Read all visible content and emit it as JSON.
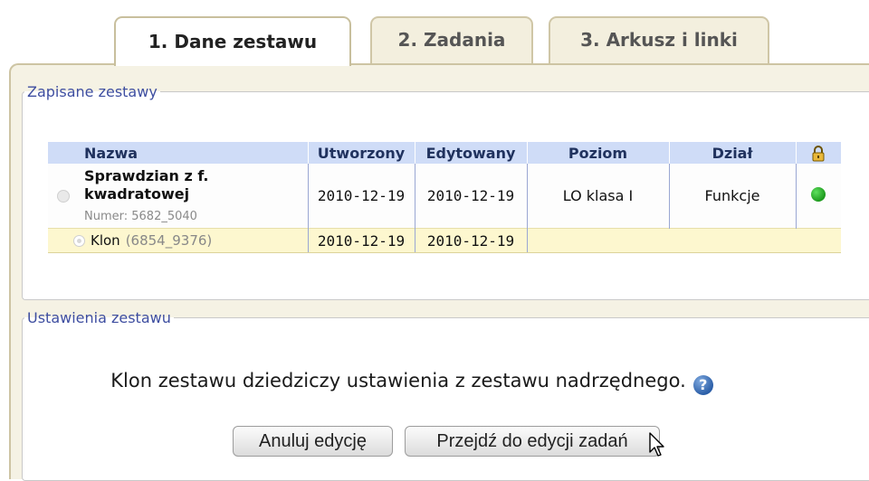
{
  "tabs": [
    {
      "label": "1. Dane zestawu",
      "active": true
    },
    {
      "label": "2. Zadania",
      "active": false
    },
    {
      "label": "3. Arkusz i linki",
      "active": false
    }
  ],
  "saved_sets": {
    "legend": "Zapisane zestawy",
    "columns": {
      "name": "Nazwa",
      "created": "Utworzony",
      "edited": "Edytowany",
      "level": "Poziom",
      "section": "Dział",
      "lock_icon": "lock-icon"
    },
    "rows": [
      {
        "name_line1": "Sprawdzian z f.",
        "name_line2": "kwadratowej",
        "number": "Numer: 5682_5040",
        "created": "2010-12-19",
        "edited": "2010-12-19",
        "level": "LO klasa I",
        "section": "Funkcje",
        "status_color": "#22aa22"
      },
      {
        "name": "Klon",
        "number": "(6854_9376)",
        "created": "2010-12-19",
        "edited": "2010-12-19"
      }
    ]
  },
  "settings": {
    "legend": "Ustawienia zestawu",
    "info_text": "Klon zestawu dziedziczy ustawienia z zestawu nadrzędnego.",
    "help_icon": "?",
    "cancel_label": "Anuluj edycję",
    "proceed_label": "Przejdź do edycji zadań"
  },
  "colors": {
    "tab_bg": "#f3efde",
    "header_bg": "#cfdcf7",
    "highlight_row": "#fdf7cf",
    "legend_text": "#3e4ea0"
  }
}
